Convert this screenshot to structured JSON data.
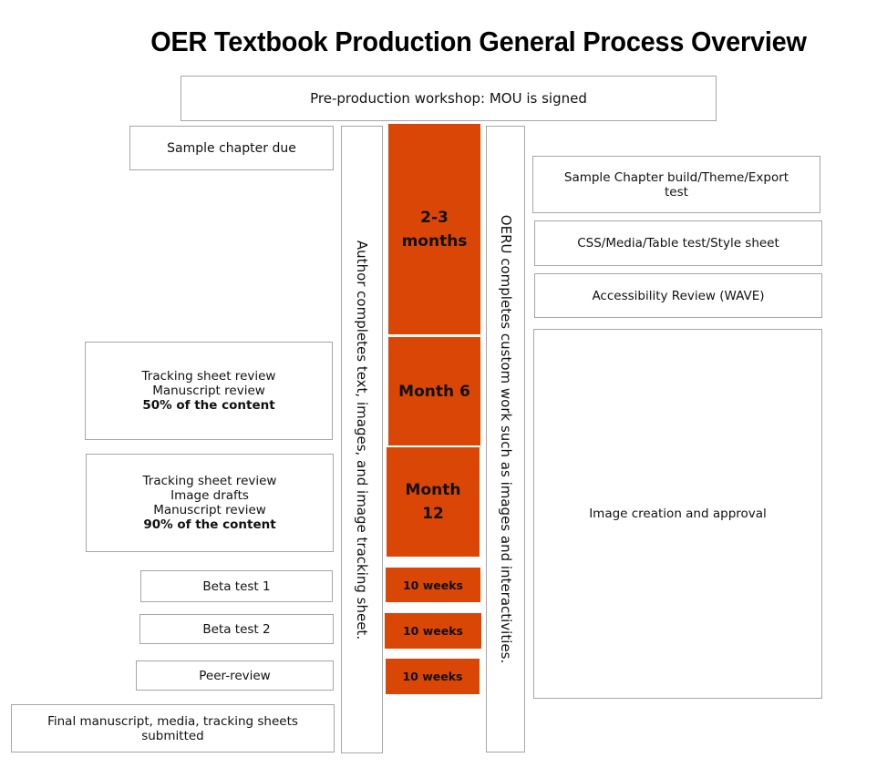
{
  "title": "OER Textbook Production General Process Overview",
  "colors": {
    "accent": "#da4605",
    "border": "#a6a6a6",
    "text": "#111111"
  },
  "top_box": "Pre-production workshop: MOU is signed",
  "author_column": "Author completes text, images, and image tracking sheet.",
  "oeru_column": "OERU completes custom work such as images and interactivities.",
  "timeline": [
    {
      "label_lines": [
        "2-3",
        "months"
      ]
    },
    {
      "label_lines": [
        "Month 6"
      ]
    },
    {
      "label_lines": [
        "Month",
        "12"
      ]
    },
    {
      "label_lines": [
        "10 weeks"
      ]
    },
    {
      "label_lines": [
        "10 weeks"
      ]
    },
    {
      "label_lines": [
        "10 weeks"
      ]
    }
  ],
  "author_milestones": [
    {
      "lines": [
        "Sample chapter due"
      ],
      "bold": ""
    },
    {
      "lines": [
        "Tracking sheet review",
        "Manuscript review"
      ],
      "bold": "50% of the content"
    },
    {
      "lines": [
        "Tracking sheet review",
        "Image drafts",
        "Manuscript review"
      ],
      "bold": "90% of the content"
    },
    {
      "lines": [
        "Beta test 1"
      ],
      "bold": ""
    },
    {
      "lines": [
        "Beta test 2"
      ],
      "bold": ""
    },
    {
      "lines": [
        "Peer-review"
      ],
      "bold": ""
    },
    {
      "lines": [
        "Final manuscript, media, tracking sheets",
        "submitted"
      ],
      "bold": ""
    }
  ],
  "oeru_tasks": [
    {
      "lines": [
        "Sample Chapter build/Theme/Export",
        "test"
      ]
    },
    {
      "lines": [
        "CSS/Media/Table test/Style sheet"
      ]
    },
    {
      "lines": [
        "Accessibility Review (WAVE)"
      ]
    },
    {
      "lines": [
        "Image creation and approval"
      ]
    }
  ]
}
